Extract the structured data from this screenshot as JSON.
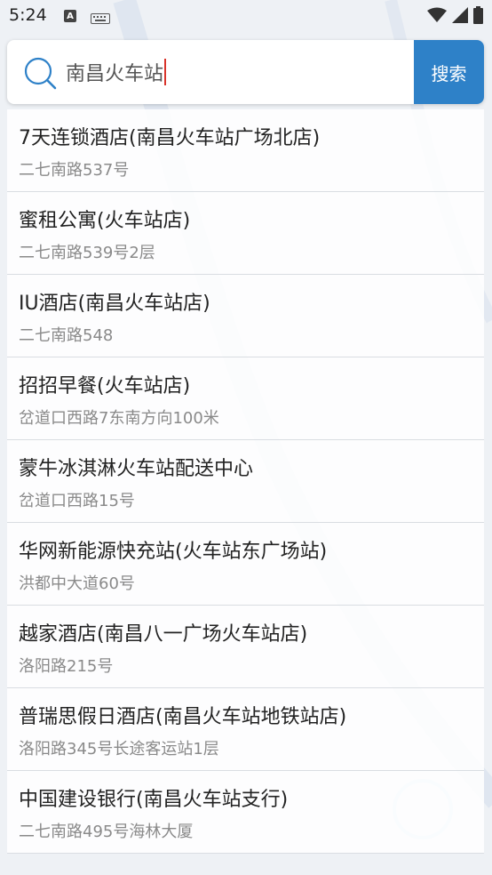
{
  "status_bar": {
    "time": "5:24",
    "icons": [
      "a-notification-icon",
      "keyboard-icon",
      "wifi-icon",
      "signal-icon",
      "battery-icon"
    ]
  },
  "search": {
    "query": "南昌火车站",
    "button_label": "搜索",
    "accent_color": "#2e81c8"
  },
  "results": [
    {
      "title": "7天连锁酒店(南昌火车站广场北店)",
      "address": "二七南路537号"
    },
    {
      "title": "蜜租公寓(火车站店)",
      "address": "二七南路539号2层"
    },
    {
      "title": "IU酒店(南昌火车站店)",
      "address": "二七南路548"
    },
    {
      "title": "招招早餐(火车站店)",
      "address": "岔道口西路7东南方向100米"
    },
    {
      "title": "蒙牛冰淇淋火车站配送中心",
      "address": "岔道口西路15号"
    },
    {
      "title": "华网新能源快充站(火车站东广场站)",
      "address": "洪都中大道60号"
    },
    {
      "title": "越家酒店(南昌八一广场火车站店)",
      "address": "洛阳路215号"
    },
    {
      "title": "普瑞思假日酒店(南昌火车站地铁站店)",
      "address": "洛阳路345号长途客运站1层"
    },
    {
      "title": "中国建设银行(南昌火车站支行)",
      "address": "二七南路495号海林大厦"
    }
  ]
}
